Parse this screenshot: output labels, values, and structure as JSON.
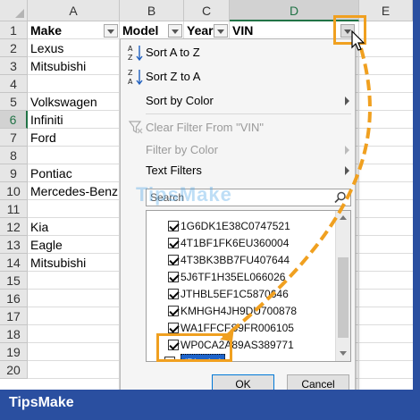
{
  "columns": [
    "A",
    "B",
    "C",
    "D",
    "E"
  ],
  "rows": [
    "1",
    "2",
    "3",
    "4",
    "5",
    "6",
    "7",
    "8",
    "9",
    "10",
    "11",
    "12",
    "13",
    "14",
    "15",
    "16",
    "17",
    "18",
    "19",
    "20"
  ],
  "headers": {
    "make": "Make",
    "model": "Model",
    "year": "Year",
    "vin": "VIN"
  },
  "make_values": [
    "Lexus",
    "Mitsubishi",
    "",
    "Volkswagen",
    "Infiniti",
    "Ford",
    "",
    "Pontiac",
    "Mercedes-Benz",
    "",
    "Kia",
    "Eagle",
    "Mitsubishi"
  ],
  "menu": {
    "sort_az": "Sort A to Z",
    "sort_za": "Sort Z to A",
    "sort_color": "Sort by Color",
    "clear_filter": "Clear Filter From \"VIN\"",
    "filter_color": "Filter by Color",
    "text_filters": "Text Filters",
    "search_placeholder": "Search"
  },
  "list_items": [
    {
      "label": "1G6DK1E38C0747521",
      "checked": true
    },
    {
      "label": "4T1BF1FK6EU360004",
      "checked": true
    },
    {
      "label": "4T3BK3BB7FU407644",
      "checked": true
    },
    {
      "label": "5J6TF1H35EL066026",
      "checked": true
    },
    {
      "label": "JTHBL5EF1C5870646",
      "checked": true
    },
    {
      "label": "KMHGH4JH9DU700878",
      "checked": true
    },
    {
      "label": "WA1FFCFS9FR006105",
      "checked": true
    },
    {
      "label": "WP0CA2A89AS389771",
      "checked": true
    },
    {
      "label": "(Blanks)",
      "checked": false
    }
  ],
  "buttons": {
    "ok": "OK",
    "cancel": "Cancel"
  },
  "brand": "TipsMake",
  "watermark": "TipsMake",
  "colors": {
    "highlight": "#f0a020",
    "excel_green": "#217346",
    "brand_blue": "#2a4fa0",
    "selection": "#1e63c8"
  }
}
